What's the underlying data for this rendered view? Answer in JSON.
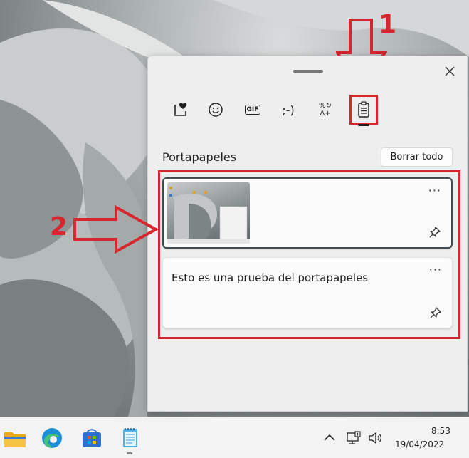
{
  "panel": {
    "tabs": [
      {
        "id": "kaomoji-favorites",
        "icon": "favorites-heart-icon"
      },
      {
        "id": "emoji",
        "icon": "emoji-smile-icon"
      },
      {
        "id": "gif",
        "icon": "gif-icon",
        "label": "GIF"
      },
      {
        "id": "kaomoji",
        "icon": "kaomoji-icon",
        "label": ";-)"
      },
      {
        "id": "symbols",
        "icon": "symbols-icon",
        "label": "%↻\nΔ+"
      },
      {
        "id": "clipboard",
        "icon": "clipboard-icon"
      }
    ],
    "section_title": "Portapapeles",
    "clear_all_label": "Borrar todo",
    "items": [
      {
        "type": "image",
        "more_label": "···"
      },
      {
        "type": "text",
        "text": "Esto es una prueba del portapapeles",
        "more_label": "···"
      }
    ]
  },
  "annotations": {
    "arrow1_label": "1",
    "arrow2_label": "2",
    "color": "#d6262e"
  },
  "taskbar": {
    "apps": [
      "file-explorer-icon",
      "edge-icon",
      "store-icon",
      "notepad-icon"
    ],
    "time": "8:53",
    "date": "19/04/2022"
  }
}
